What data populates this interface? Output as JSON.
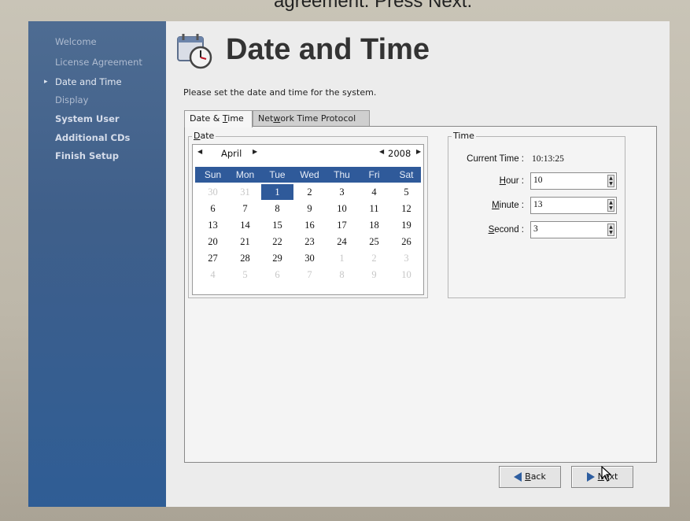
{
  "caption": "agreement. Press Next.",
  "sidebar": {
    "items": [
      {
        "label": "Welcome"
      },
      {
        "label": "License Agreement"
      },
      {
        "label": "Date and Time"
      },
      {
        "label": "Display"
      },
      {
        "label": "System User"
      },
      {
        "label": "Additional CDs"
      },
      {
        "label": "Finish Setup"
      }
    ],
    "current_marker": "▸"
  },
  "header": {
    "title": "Date and Time",
    "subtitle": "Please set the date and time for the system."
  },
  "tabs": [
    {
      "label_pre": "Date & ",
      "mnemonic": "T",
      "label_post": "ime"
    },
    {
      "label_pre": "Net",
      "mnemonic": "w",
      "label_post": "ork Time Protocol"
    }
  ],
  "date": {
    "label_mnemonic": "D",
    "label_post": "ate",
    "month": "April",
    "year": "2008",
    "weekdays": [
      "Sun",
      "Mon",
      "Tue",
      "Wed",
      "Thu",
      "Fri",
      "Sat"
    ],
    "weeks": [
      [
        "30",
        "31",
        "1",
        "2",
        "3",
        "4",
        "5"
      ],
      [
        "6",
        "7",
        "8",
        "9",
        "10",
        "11",
        "12"
      ],
      [
        "13",
        "14",
        "15",
        "16",
        "17",
        "18",
        "19"
      ],
      [
        "20",
        "21",
        "22",
        "23",
        "24",
        "25",
        "26"
      ],
      [
        "27",
        "28",
        "29",
        "30",
        "1",
        "2",
        "3"
      ],
      [
        "4",
        "5",
        "6",
        "7",
        "8",
        "9",
        "10"
      ]
    ],
    "selected_day": "1"
  },
  "time": {
    "label": "Time",
    "current_time_label": "Current Time :",
    "current_time_value": "10:13:25",
    "hour": {
      "mnemonic": "H",
      "label_post": "our :",
      "value": "10"
    },
    "minute": {
      "mnemonic": "M",
      "label_post": "inute :",
      "value": "13"
    },
    "second": {
      "mnemonic": "S",
      "label_post": "econd :",
      "value": "3"
    }
  },
  "buttons": {
    "back": {
      "mnemonic": "B",
      "label_post": "ack"
    },
    "next": {
      "mnemonic": "N",
      "label_post": "ext"
    }
  },
  "colors": {
    "sidebar": "#3f5f8a",
    "selection": "#2f5a9a",
    "arrow": "#2e5ea0"
  },
  "icons": {
    "title": "calendar-clock-icon",
    "back": "back-arrow-icon",
    "next": "next-arrow-icon"
  }
}
